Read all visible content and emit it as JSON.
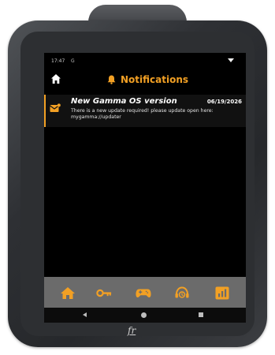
{
  "status_bar": {
    "time": "17:47",
    "indicator": "G",
    "wifi_icon": "wifi-icon"
  },
  "header": {
    "home_icon": "home-icon",
    "bell_icon": "bell-icon",
    "title": "Notifications",
    "accent_color": "#f2a024"
  },
  "notifications": [
    {
      "icon": "mail-icon",
      "title": "New Gamma OS version",
      "date": "06/19/2026",
      "body": "There is a new update required! please update open here: mygamma://updater"
    }
  ],
  "bottom_bar": {
    "items": [
      {
        "icon": "home-icon"
      },
      {
        "icon": "key-icon"
      },
      {
        "icon": "gamepad-icon"
      },
      {
        "icon": "support-icon"
      },
      {
        "icon": "chart-icon"
      }
    ],
    "background": "#6b6b6b"
  },
  "system_nav": [
    "back",
    "home",
    "recents"
  ],
  "brand": {
    "logo_text": "fr"
  }
}
